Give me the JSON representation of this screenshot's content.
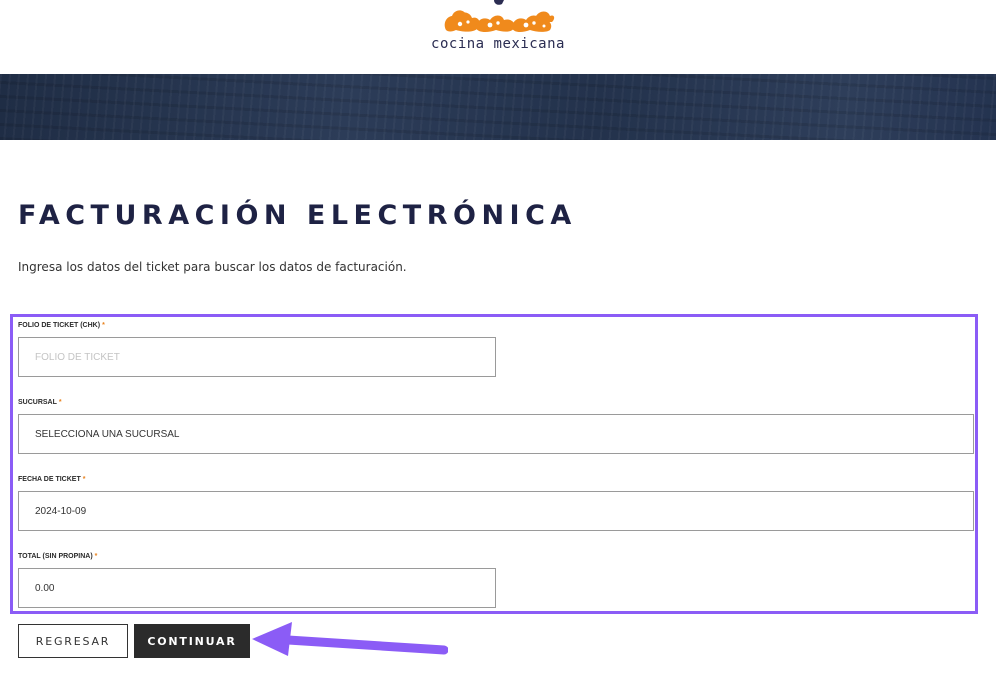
{
  "header": {
    "tagline": "cocina mexicana"
  },
  "page": {
    "title": "FACTURACIÓN ELECTRÓNICA",
    "subtitle": "Ingresa los datos del ticket para buscar los datos de facturación."
  },
  "form": {
    "folio": {
      "label": "FOLIO DE TICKET (CHK)",
      "required_mark": "*",
      "placeholder": "FOLIO DE TICKET",
      "value": ""
    },
    "sucursal": {
      "label": "SUCURSAL",
      "required_mark": "*",
      "value": "SELECCIONA UNA SUCURSAL"
    },
    "fecha": {
      "label": "FECHA DE TICKET",
      "required_mark": "*",
      "value": "2024-10-09"
    },
    "total": {
      "label": "TOTAL (SIN PROPINA)",
      "required_mark": "*",
      "value": "0.00"
    }
  },
  "buttons": {
    "back_label": "REGRESAR",
    "continue_label": "CONTINUAR"
  },
  "colors": {
    "accent_orange": "#e8821e",
    "highlight_purple": "#8b5cf6",
    "title_navy": "#1e2244"
  }
}
